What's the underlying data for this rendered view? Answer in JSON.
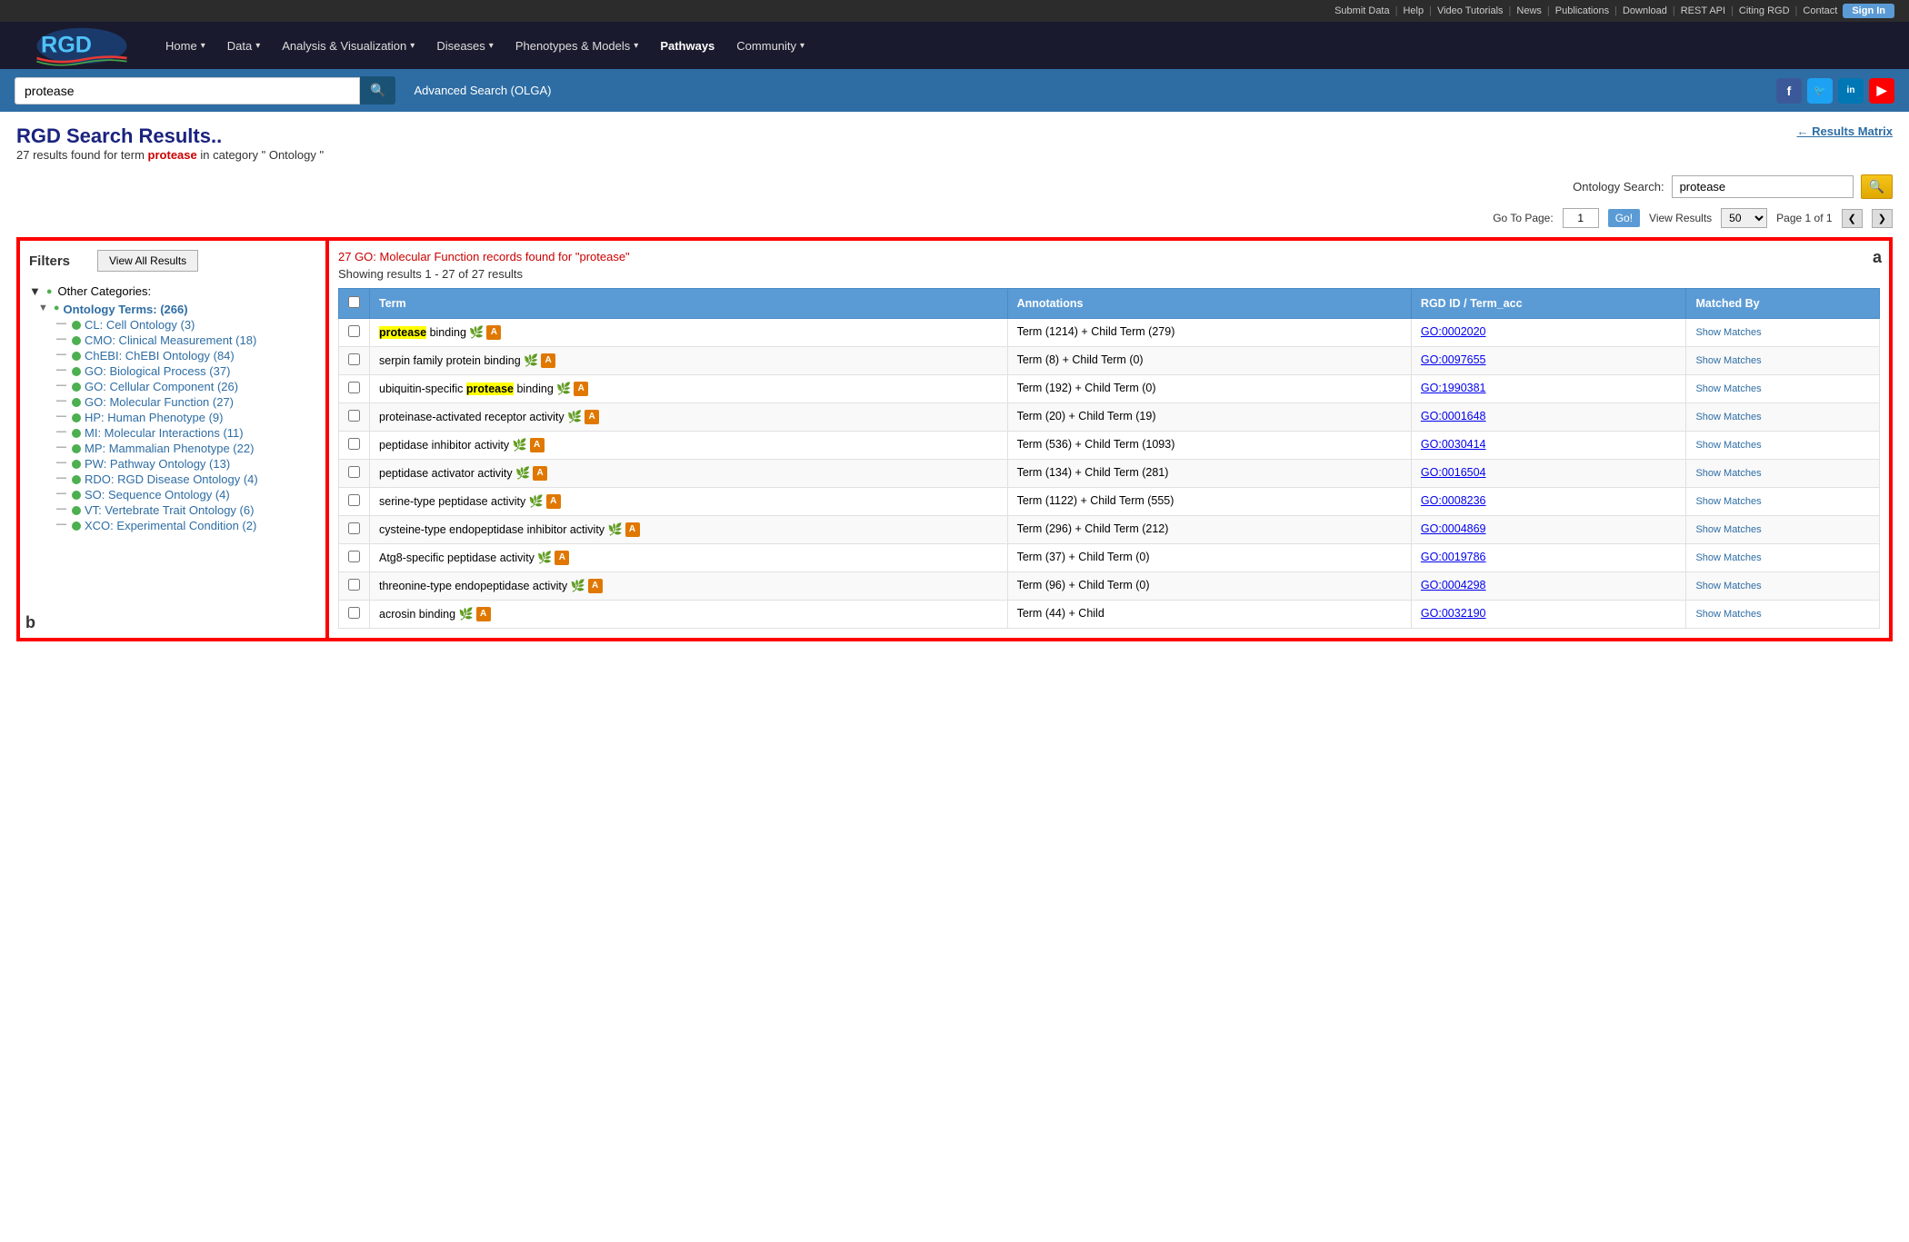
{
  "topbar": {
    "links": [
      "Submit Data",
      "Help",
      "Video Tutorials",
      "News",
      "Publications",
      "Download",
      "REST API",
      "Citing RGD",
      "Contact"
    ],
    "sign_in": "Sign In"
  },
  "nav": {
    "items": [
      {
        "label": "Home",
        "has_dropdown": true
      },
      {
        "label": "Data",
        "has_dropdown": true
      },
      {
        "label": "Analysis & Visualization",
        "has_dropdown": true
      },
      {
        "label": "Diseases",
        "has_dropdown": true
      },
      {
        "label": "Phenotypes & Models",
        "has_dropdown": true
      },
      {
        "label": "Pathways",
        "has_dropdown": false,
        "active": true
      },
      {
        "label": "Community",
        "has_dropdown": true
      }
    ]
  },
  "search_bar": {
    "query": "protease",
    "search_icon": "🔍",
    "advanced_search": "Advanced Search (OLGA)",
    "social": [
      "f",
      "in",
      "in",
      "▶"
    ]
  },
  "page": {
    "title": "RGD Search Results..",
    "subtitle_count": "27",
    "subtitle_term": "protease",
    "subtitle_category": "Ontology",
    "results_matrix": "← Results Matrix",
    "ontology_search_label": "Ontology Search:",
    "ontology_search_value": "protease",
    "go_to_page_label": "Go To Page:",
    "go_to_page_value": "1",
    "go_btn": "Go!",
    "view_results_label": "View Results",
    "view_results_value": "50",
    "page_info": "Page 1 of 1",
    "prev_btn": "❮",
    "next_btn": "❯"
  },
  "filters": {
    "title": "Filters",
    "view_all_btn": "View All Results",
    "other_categories": "Other Categories:",
    "tree": {
      "ontology_terms_label": "Ontology Terms: (266)",
      "items": [
        {
          "label": "CL: Cell Ontology (3)"
        },
        {
          "label": "CMO: Clinical Measurement (18)"
        },
        {
          "label": "ChEBI: ChEBI Ontology (84)"
        },
        {
          "label": "GO: Biological Process (37)"
        },
        {
          "label": "GO: Cellular Component (26)"
        },
        {
          "label": "GO: Molecular Function (27)"
        },
        {
          "label": "HP: Human Phenotype (9)"
        },
        {
          "label": "MI: Molecular Interactions (11)"
        },
        {
          "label": "MP: Mammalian Phenotype (22)"
        },
        {
          "label": "PW: Pathway Ontology (13)"
        },
        {
          "label": "RDO: RGD Disease Ontology (4)"
        },
        {
          "label": "SO: Sequence Ontology (4)"
        },
        {
          "label": "VT: Vertebrate Trait Ontology (6)"
        },
        {
          "label": "XCO: Experimental Condition (2)"
        }
      ]
    }
  },
  "results": {
    "go_mol_func_banner": "27 GO: Molecular Function records found for \"protease\"",
    "showing": "Showing results 1 - 27 of 27 results",
    "label_a": "a",
    "label_b": "b",
    "columns": [
      "",
      "Term",
      "Annotations",
      "RGD ID / Term_acc",
      "Matched By"
    ],
    "rows": [
      {
        "term": "protease binding",
        "term_highlight": "protease",
        "annotations": "Term (1214) + Child Term (279)",
        "rgd_id": "GO:0002020",
        "matched_by": "Show Matches"
      },
      {
        "term": "serpin family protein binding",
        "term_highlight": "",
        "annotations": "Term (8) + Child Term (0)",
        "rgd_id": "GO:0097655",
        "matched_by": "Show Matches"
      },
      {
        "term": "ubiquitin-specific protease binding",
        "term_highlight": "protease",
        "annotations": "Term (192) + Child Term (0)",
        "rgd_id": "GO:1990381",
        "matched_by": "Show Matches"
      },
      {
        "term": "proteinase-activated receptor activity",
        "term_highlight": "",
        "annotations": "Term (20) + Child Term (19)",
        "rgd_id": "GO:0001648",
        "matched_by": "Show Matches"
      },
      {
        "term": "peptidase inhibitor activity",
        "term_highlight": "",
        "annotations": "Term (536) + Child Term (1093)",
        "rgd_id": "GO:0030414",
        "matched_by": "Show Matches"
      },
      {
        "term": "peptidase activator activity",
        "term_highlight": "",
        "annotations": "Term (134) + Child Term (281)",
        "rgd_id": "GO:0016504",
        "matched_by": "Show Matches"
      },
      {
        "term": "serine-type peptidase activity",
        "term_highlight": "",
        "annotations": "Term (1122) + Child Term (555)",
        "rgd_id": "GO:0008236",
        "matched_by": "Show Matches"
      },
      {
        "term": "cysteine-type endopeptidase inhibitor activity",
        "term_highlight": "",
        "annotations": "Term (296) + Child Term (212)",
        "rgd_id": "GO:0004869",
        "matched_by": "Show Matches"
      },
      {
        "term": "Atg8-specific peptidase activity",
        "term_highlight": "",
        "annotations": "Term (37) + Child Term (0)",
        "rgd_id": "GO:0019786",
        "matched_by": "Show Matches"
      },
      {
        "term": "threonine-type endopeptidase activity",
        "term_highlight": "",
        "annotations": "Term (96) + Child Term (0)",
        "rgd_id": "GO:0004298",
        "matched_by": "Show Matches"
      },
      {
        "term": "acrosin binding",
        "term_highlight": "",
        "annotations": "Term (44) + Child",
        "rgd_id": "GO:0032190",
        "matched_by": "Show Matches"
      }
    ]
  }
}
